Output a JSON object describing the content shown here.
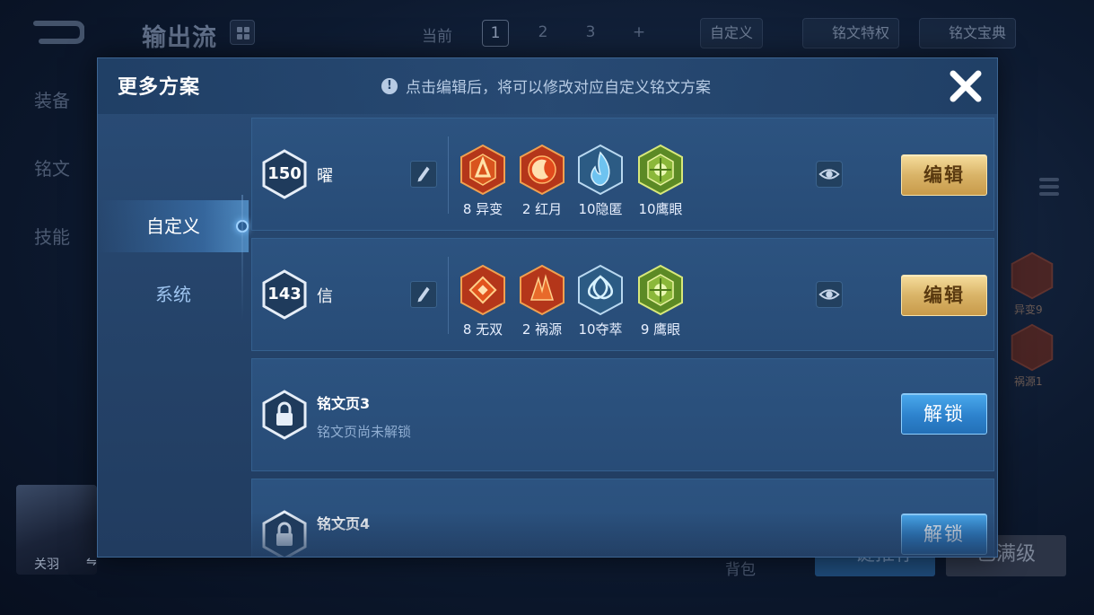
{
  "background": {
    "title": "输出流",
    "current_label": "当前",
    "pages": [
      "1",
      "2",
      "3",
      "+"
    ],
    "chips": [
      "自定义",
      "铭文特权",
      "铭文宝典"
    ],
    "side_menu": [
      "装备",
      "铭文",
      "技能"
    ],
    "rune_labels": [
      "异变9",
      "祸源1"
    ],
    "hero_name": "关羽",
    "swap_glyph": "⇋",
    "footer_text": "背包",
    "footer_buttons": [
      "一键推荐",
      "已满级"
    ]
  },
  "modal": {
    "title": "更多方案",
    "tip_icon": "!",
    "tip": "点击编辑后，将可以修改对应自定义铭文方案",
    "close_icon": "close-icon",
    "nav": [
      {
        "label": "自定义",
        "active": true
      },
      {
        "label": "系统",
        "active": false
      }
    ],
    "rune_pages": [
      {
        "level": "150",
        "name": "曜",
        "runes": [
          {
            "label": "8 异变",
            "color": "#c8401c",
            "icon": "rune-red-icon"
          },
          {
            "label": "2 红月",
            "color": "#d2481e",
            "icon": "rune-red-moon-icon"
          },
          {
            "label": "10隐匿",
            "color": "#3f9ed8",
            "icon": "rune-blue-flame-icon"
          },
          {
            "label": "10鹰眼",
            "color": "#7fae32",
            "icon": "rune-green-icon"
          }
        ],
        "button": "编辑"
      },
      {
        "level": "143",
        "name": "信",
        "runes": [
          {
            "label": "8 无双",
            "color": "#c8401c",
            "icon": "rune-red-diamond-icon"
          },
          {
            "label": "2 祸源",
            "color": "#d2481e",
            "icon": "rune-red-shard-icon"
          },
          {
            "label": "10夺萃",
            "color": "#4a8ec4",
            "icon": "rune-blue-knot-icon"
          },
          {
            "label": "9 鹰眼",
            "color": "#7fae32",
            "icon": "rune-green-icon"
          }
        ],
        "button": "编辑"
      }
    ],
    "locked_pages": [
      {
        "title": "铭文页3",
        "subtitle": "铭文页尚未解锁",
        "button": "解锁"
      },
      {
        "title": "铭文页4",
        "subtitle": "",
        "button": "解锁"
      }
    ]
  },
  "colors": {
    "gold_button": "#d9b468",
    "blue_button": "#2d82cd",
    "panel": "#26456c"
  }
}
